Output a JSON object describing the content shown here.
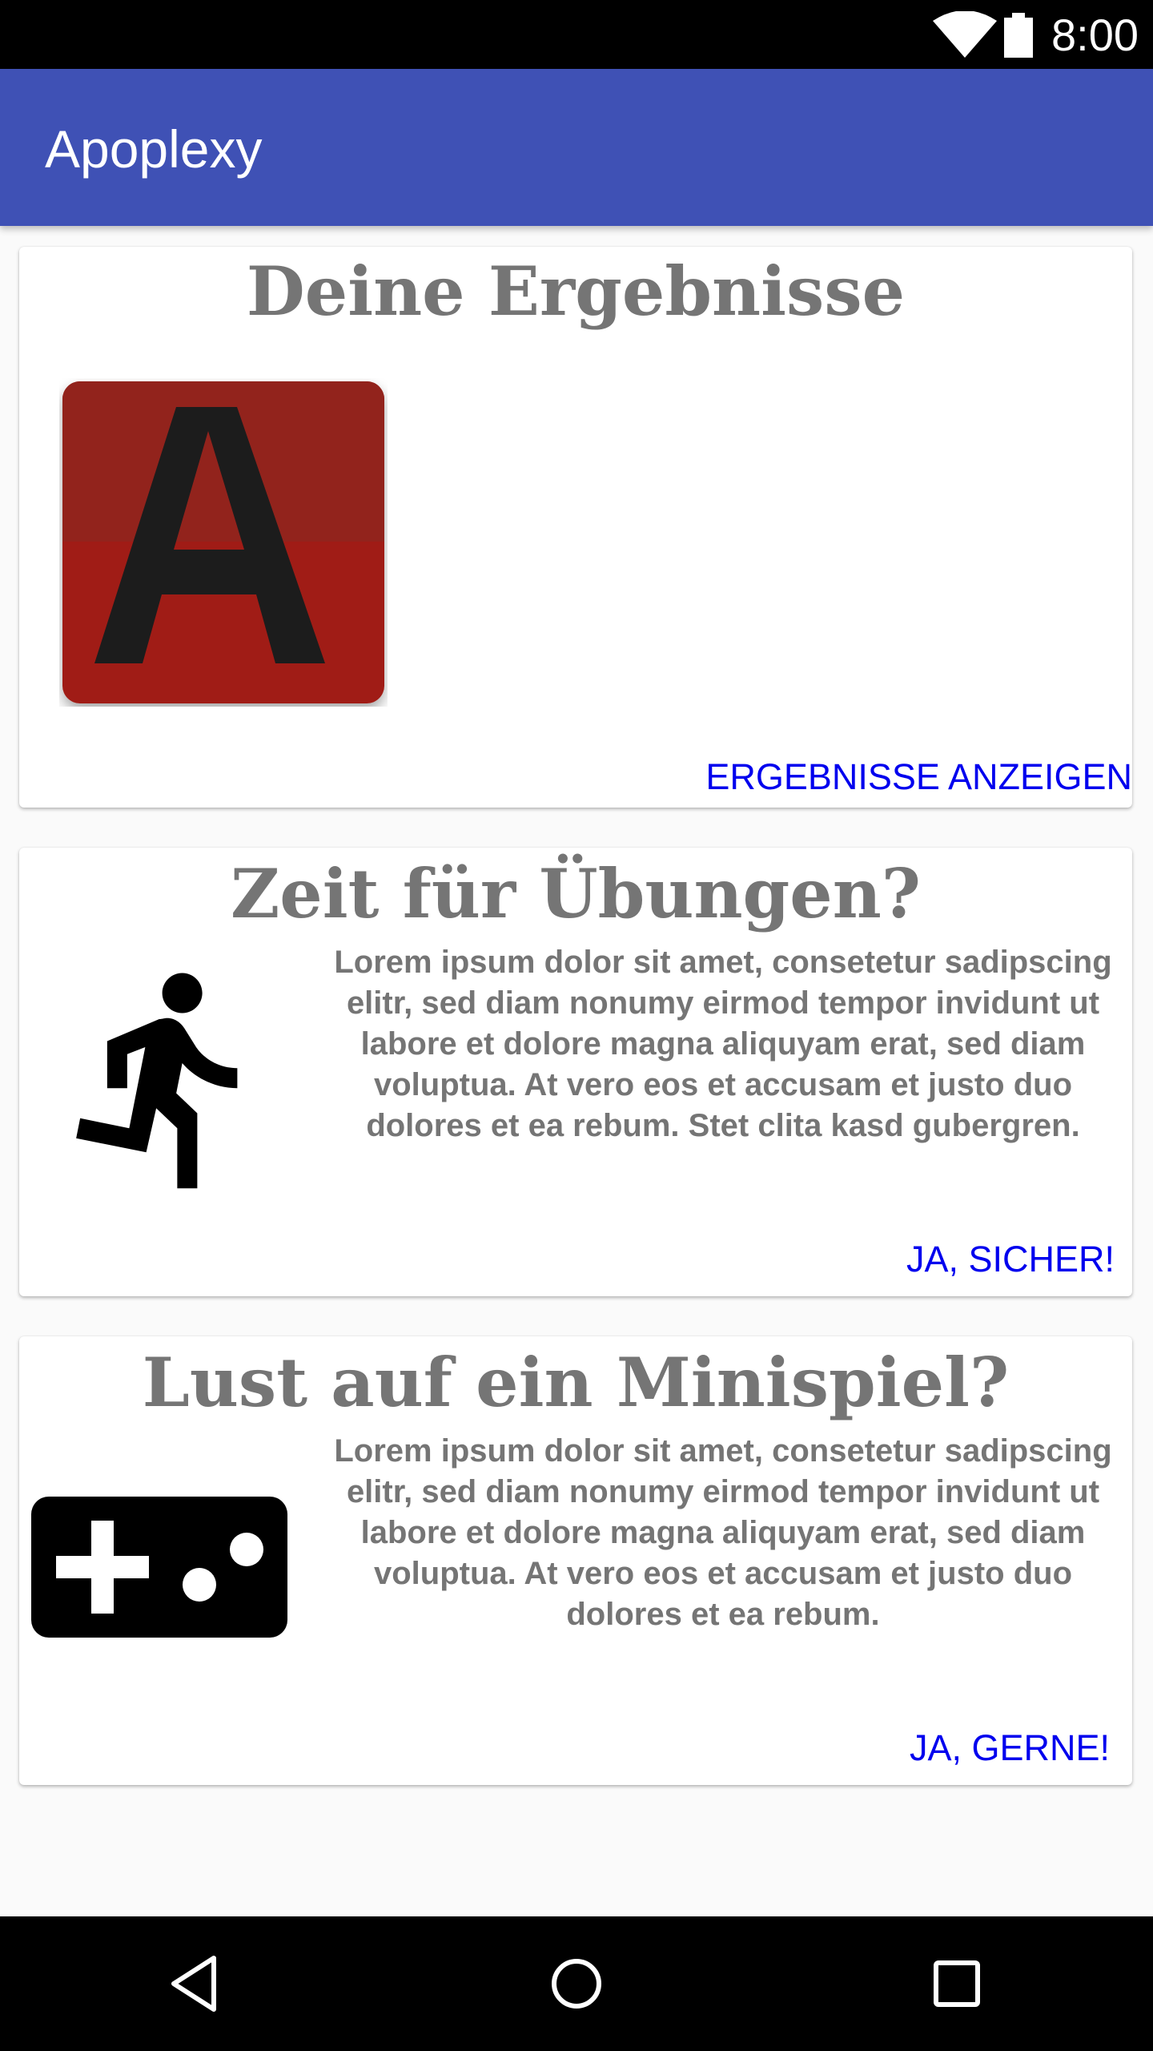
{
  "status_bar": {
    "time": "8:00",
    "icons": [
      "wifi-icon",
      "battery-icon"
    ]
  },
  "app_bar": {
    "title": "Apoplexy",
    "color": "#3f51b5"
  },
  "cards": [
    {
      "title": "Deine Ergebnisse",
      "icon": "app-logo-icon",
      "icon_letter": "A",
      "action": "ERGEBNISSE ANZEIGEN"
    },
    {
      "title": "Zeit für Übungen?",
      "icon": "running-person-icon",
      "body": "Lorem ipsum dolor sit amet, consetetur sadipscing elitr, sed diam nonumy eirmod tempor invidunt ut labore et dolore magna aliquyam erat, sed diam voluptua. At vero eos et accusam et justo duo dolores et ea rebum. Stet clita kasd gubergren.",
      "action": "JA, SICHER!"
    },
    {
      "title": "Lust auf ein Minispiel?",
      "icon": "gamepad-icon",
      "body": "Lorem ipsum dolor sit amet, consetetur sadipscing elitr, sed diam nonumy eirmod tempor invidunt ut labore et dolore magna aliquyam erat, sed diam voluptua. At vero eos et accusam et justo duo dolores et ea rebum.",
      "action": "JA, GERNE!"
    }
  ],
  "colors": {
    "accent_link": "#0000ee",
    "card_text": "#757575",
    "logo_red": "#a01a12"
  },
  "nav_bar": {
    "buttons": [
      "back-icon",
      "home-icon",
      "recents-icon"
    ]
  }
}
